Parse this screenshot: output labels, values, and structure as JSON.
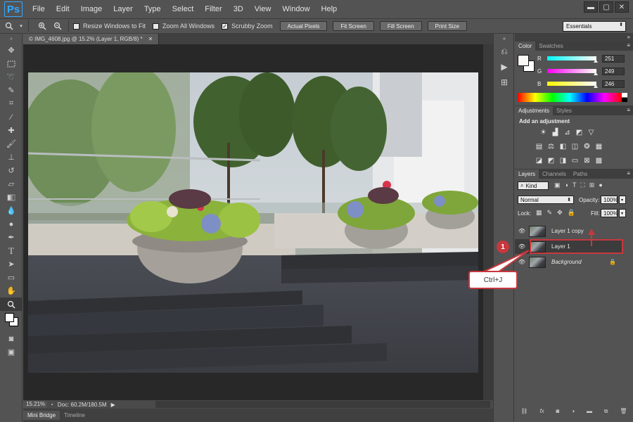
{
  "app": {
    "logo_text": "Ps"
  },
  "menubar": {
    "items": [
      "File",
      "Edit",
      "Image",
      "Layer",
      "Type",
      "Select",
      "Filter",
      "3D",
      "View",
      "Window",
      "Help"
    ]
  },
  "window_controls": {
    "minimize": "▬",
    "maximize": "▢",
    "close": "✕"
  },
  "options_bar": {
    "resize_windows_label": "Resize Windows to Fit",
    "resize_windows_checked": false,
    "zoom_all_label": "Zoom All Windows",
    "zoom_all_checked": false,
    "scrubby_zoom_label": "Scrubby Zoom",
    "scrubby_zoom_checked": true,
    "actual_pixels_label": "Actual Pixels",
    "fit_screen_label": "Fit Screen",
    "fill_screen_label": "Fill Screen",
    "print_size_label": "Print Size",
    "workspace": "Essentials"
  },
  "document": {
    "tab_label": "© IMG_4608.jpg @ 15.2% (Layer 1, RGB/8) *",
    "zoom": "15.21%",
    "doc_info": "Doc: 60.2M/180.5M"
  },
  "bottom_tabs": [
    "Mini Bridge",
    "Timeline"
  ],
  "color_panel": {
    "tabs": [
      "Color",
      "Swatches"
    ],
    "r_label": "R",
    "r_value": "251",
    "g_label": "G",
    "g_value": "249",
    "b_label": "B",
    "b_value": "246",
    "swatch_color": "#fbf9f6"
  },
  "adjustments_panel": {
    "tabs": [
      "Adjustments",
      "Styles"
    ],
    "title": "Add an adjustment"
  },
  "layers_panel": {
    "tabs": [
      "Layers",
      "Channels",
      "Paths"
    ],
    "filter_kind": "Kind",
    "blend_mode": "Normal",
    "opacity_label": "Opacity:",
    "opacity_value": "100%",
    "lock_label": "Lock:",
    "fill_label": "Fill:",
    "fill_value": "100%",
    "layers": [
      {
        "name": "Layer 1 copy"
      },
      {
        "name": "Layer 1"
      },
      {
        "name": "Background"
      }
    ]
  },
  "annotation": {
    "badge_number": "1",
    "callout_text": "Ctrl+J",
    "accent_color": "#c7383e"
  }
}
